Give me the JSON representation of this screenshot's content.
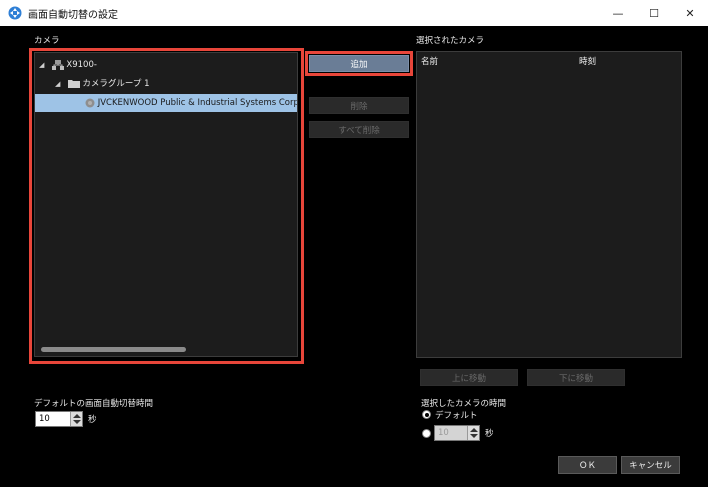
{
  "window": {
    "title": "画面自動切替の設定",
    "minimize_glyph": "—",
    "maximize_glyph": "☐",
    "close_glyph": "✕"
  },
  "camera_section": {
    "label": "カメラ",
    "tree": [
      {
        "toggle": "◢",
        "icon": "server-icon",
        "label": "X9100-",
        "selected": false
      },
      {
        "toggle": "◢",
        "icon": "folder-icon",
        "label": "カメラグループ 1",
        "selected": false
      },
      {
        "toggle": "",
        "icon": "camera-icon",
        "label": "JVCKENWOOD Public & Industrial Systems Corp",
        "selected": true
      }
    ]
  },
  "buttons": {
    "add": "追加",
    "delete": "削除",
    "delete_all": "すべて削除",
    "move_up": "上に移動",
    "move_down": "下に移動",
    "ok": "ＯＫ",
    "cancel": "キャンセル"
  },
  "selected_cameras": {
    "label": "選択されたカメラ",
    "columns": {
      "name": "名前",
      "time": "時刻"
    },
    "rows": []
  },
  "default_interval": {
    "label": "デフォルトの画面自動切替時間",
    "value": "10",
    "unit": "秒"
  },
  "selected_camera_interval": {
    "label": "選択したカメラの時間",
    "option_default": "デフォルト",
    "value": "10",
    "unit": "秒",
    "selected_option": "default"
  },
  "colors": {
    "highlight": "#e8463a",
    "selection": "#9ec3e6",
    "primary_button": "#6a7d96"
  }
}
